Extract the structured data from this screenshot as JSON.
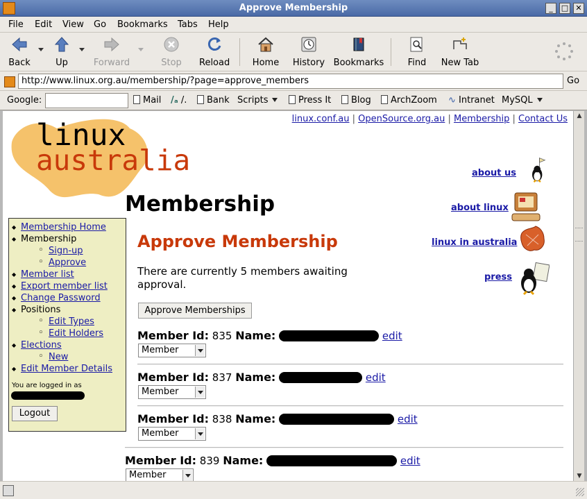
{
  "window": {
    "title": "Approve Membership"
  },
  "menu": [
    {
      "label": "File",
      "key": "F"
    },
    {
      "label": "Edit",
      "key": "E"
    },
    {
      "label": "View",
      "key": "V"
    },
    {
      "label": "Go",
      "key": "G"
    },
    {
      "label": "Bookmarks",
      "key": "B"
    },
    {
      "label": "Tabs",
      "key": "T"
    },
    {
      "label": "Help",
      "key": "H"
    }
  ],
  "toolbar": {
    "back": "Back",
    "up": "Up",
    "forward": "Forward",
    "stop": "Stop",
    "reload": "Reload",
    "home": "Home",
    "history": "History",
    "bookmarks": "Bookmarks",
    "find": "Find",
    "newtab": "New Tab"
  },
  "urlbar": {
    "url": "http://www.linux.org.au/membership/?page=approve_members",
    "go": "Go"
  },
  "personal": {
    "google_label": "Google:",
    "items": [
      "Mail",
      "/.",
      "Bank",
      "Scripts",
      "Press It",
      "Blog",
      "ArchZoom",
      "Intranet",
      "MySQL"
    ]
  },
  "page": {
    "top_links": [
      "linux.conf.au",
      "OpenSource.org.au",
      "Membership",
      "Contact Us"
    ],
    "logo_top": "linux",
    "logo_bottom": "australia",
    "title": "Membership",
    "subtitle": "Approve Membership",
    "description": "There are currently 5 members awaiting approval.",
    "approve_button": "Approve Memberships",
    "right_nav": [
      "about us",
      "about linux",
      "linux in australia",
      "press"
    ],
    "sidebar": {
      "items": [
        {
          "label": "Membership Home",
          "link": true,
          "level": 0
        },
        {
          "label": "Membership",
          "link": false,
          "level": 0
        },
        {
          "label": "Sign-up",
          "link": true,
          "level": 1
        },
        {
          "label": "Approve",
          "link": true,
          "level": 1
        },
        {
          "label": "Member list",
          "link": true,
          "level": 0
        },
        {
          "label": "Export member list",
          "link": true,
          "level": 0
        },
        {
          "label": "Change Password",
          "link": true,
          "level": 0
        },
        {
          "label": "Positions",
          "link": false,
          "level": 0
        },
        {
          "label": "Edit Types",
          "link": true,
          "level": 1
        },
        {
          "label": "Edit Holders",
          "link": true,
          "level": 1
        },
        {
          "label": "Elections",
          "link": true,
          "level": 0
        },
        {
          "label": "New",
          "link": true,
          "level": 1
        },
        {
          "label": "Edit Member Details",
          "link": true,
          "level": 0
        }
      ],
      "logged_in_label": "You are logged in as",
      "logout": "Logout"
    },
    "members": [
      {
        "id_label": "Member Id:",
        "id": "835",
        "name_label": "Name:",
        "edit": "edit",
        "type": "Member"
      },
      {
        "id_label": "Member Id:",
        "id": "837",
        "name_label": "Name:",
        "edit": "edit",
        "type": "Member"
      },
      {
        "id_label": "Member Id:",
        "id": "838",
        "name_label": "Name:",
        "edit": "edit",
        "type": "Member"
      },
      {
        "id_label": "Member Id:",
        "id": "839",
        "name_label": "Name:",
        "edit": "edit",
        "type": "Member"
      }
    ]
  },
  "colors": {
    "accent": "#c8390a",
    "link": "#1a1aa6",
    "sidebar_bg": "#eeeec3",
    "logo_blob": "#f5c26b"
  }
}
